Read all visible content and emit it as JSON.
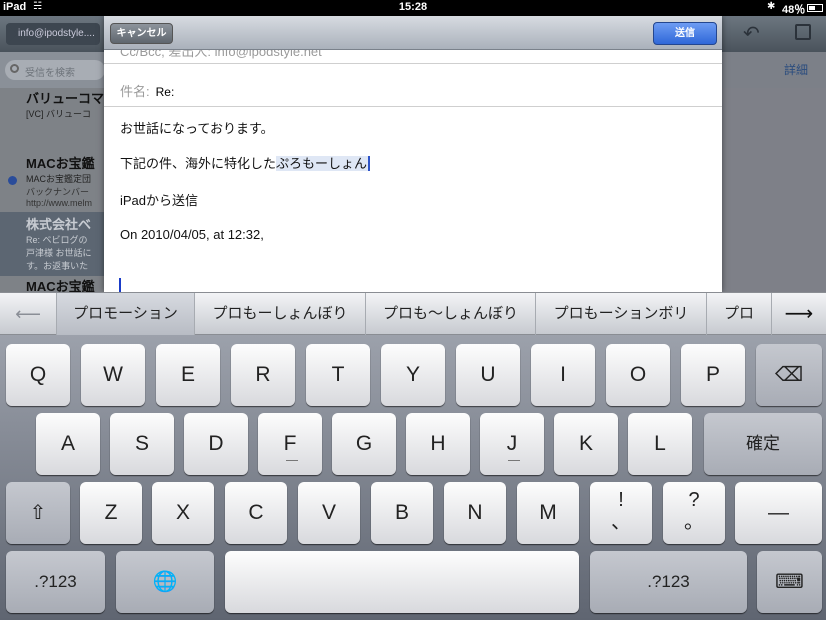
{
  "status_bar": {
    "device": "iPad",
    "time": "15:28",
    "battery": "48％"
  },
  "background": {
    "back_label": "info@ipodstyle....",
    "search_placeholder": "受信を検索",
    "detail_label": "詳細",
    "messages": [
      {
        "title": "バリューコマ",
        "line1": "[VC] バリューコ",
        "line2": ""
      },
      {
        "title": "MACお宝鑑",
        "line1": "MACお宝鑑定団",
        "line2": "バックナンバー",
        "line3": "http://www.melm"
      },
      {
        "title": "株式会社ベ",
        "line1": "Re: ベビログの",
        "line2": "戸津様 お世話に",
        "line3": "す。お返事いた"
      },
      {
        "title": "MACお宝鑑",
        "line1": "",
        "line2": ""
      }
    ]
  },
  "compose": {
    "cancel_label": "キャンセル",
    "send_label": "送信",
    "cc_row": "Cc/Bcc, 差出人: info@ipodstyle.net",
    "subject_label": "件名:",
    "subject_value": "Re:",
    "body_line1": "お世話になっております。",
    "body_line2_prefix": "下記の件、海外に特化した",
    "body_line2_marked": "ぷろもーしょん",
    "body_line3": "iPadから送信",
    "body_line4": "On 2010/04/05, at 12:32,"
  },
  "candidates": [
    "プロモーション",
    "プロもーしょんぼり",
    "プロも〜しょんぼり",
    "プロもーションボリ",
    "プロ"
  ],
  "keyboard": {
    "row1": [
      "Q",
      "W",
      "E",
      "R",
      "T",
      "Y",
      "U",
      "I",
      "O",
      "P"
    ],
    "row2": [
      "A",
      "S",
      "D",
      "F",
      "G",
      "H",
      "J",
      "K",
      "L"
    ],
    "confirm": "確定",
    "row3": [
      "Z",
      "X",
      "C",
      "V",
      "B",
      "N",
      "M"
    ],
    "excl": [
      "!",
      "、"
    ],
    "quest": [
      "?",
      "。"
    ],
    "dash": "—",
    "numbers": ".?123",
    "numbers2": ".?123"
  }
}
